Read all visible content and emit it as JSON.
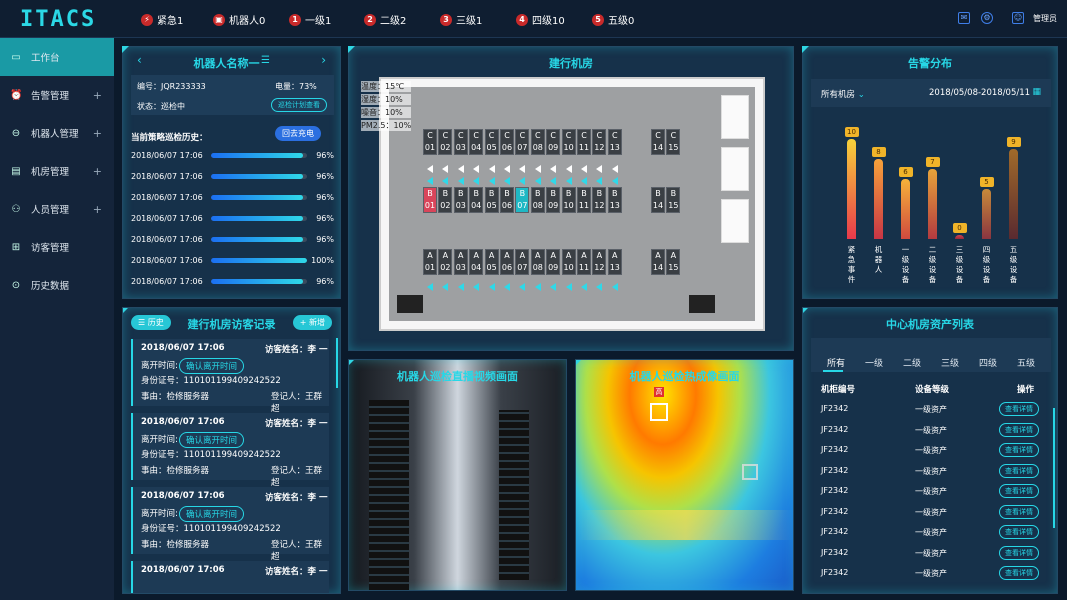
{
  "topbar": {
    "logo": "ITACS",
    "levels": [
      {
        "label": "紧急1",
        "badge": "⚡"
      },
      {
        "label": "机器人0",
        "badge": "▣"
      },
      {
        "label": "一级1",
        "badge": "1"
      },
      {
        "label": "二级2",
        "badge": "2"
      },
      {
        "label": "三级1",
        "badge": "3"
      },
      {
        "label": "四级10",
        "badge": "4"
      },
      {
        "label": "五级0",
        "badge": "5"
      }
    ],
    "mail_icon": "mail-icon",
    "settings_icon": "gear-icon",
    "user_label": "管理员"
  },
  "sidebar": {
    "items": [
      {
        "label": "工作台",
        "icon": "▭"
      },
      {
        "label": "告警管理",
        "icon": "⏰",
        "plus": "+"
      },
      {
        "label": "机器人管理",
        "icon": "⊖",
        "plus": "+"
      },
      {
        "label": "机房管理",
        "icon": "▤",
        "plus": "+"
      },
      {
        "label": "人员管理",
        "icon": "⚇",
        "plus": "+"
      },
      {
        "label": "访客管理",
        "icon": "⊞"
      },
      {
        "label": "历史数据",
        "icon": "⊙"
      }
    ]
  },
  "robot": {
    "title": "机器人名称一",
    "id": "编号：JQR233333",
    "battery": "电量：73%",
    "status": "状态：巡检中",
    "plan_btn": "巡检计划查看",
    "history_title": "当前策略巡检历史：",
    "recharge_btn": "回去充电",
    "history": [
      {
        "time": "2018/06/07  17:06",
        "value": 0.96,
        "pct": "96%"
      },
      {
        "time": "2018/06/07  17:06",
        "value": 0.96,
        "pct": "96%"
      },
      {
        "time": "2018/06/07  17:06",
        "value": 0.96,
        "pct": "96%"
      },
      {
        "time": "2018/06/07  17:06",
        "value": 0.96,
        "pct": "96%"
      },
      {
        "time": "2018/06/07  17:06",
        "value": 0.96,
        "pct": "96%"
      },
      {
        "time": "2018/06/07  17:06",
        "value": 1.0,
        "pct": "100%"
      },
      {
        "time": "2018/06/07  17:06",
        "value": 0.96,
        "pct": "96%"
      }
    ]
  },
  "visitors": {
    "history_btn": "历史",
    "title": "建行机房访客记录",
    "add_btn": "+ 新增",
    "cards": [
      {
        "date": "2018/06/07  17:06",
        "name": "访客姓名：李  一",
        "leave": "离开时间:",
        "leave_btn": "确认离开时间",
        "idno": "身份证号：110101199409242522",
        "reason": "事由：检修服务器",
        "reg": "登记人：王群超"
      },
      {
        "date": "2018/06/07  17:06",
        "name": "访客姓名：李  一",
        "leave": "离开时间:",
        "leave_btn": "确认离开时间",
        "idno": "身份证号：110101199409242522",
        "reason": "事由：检修服务器",
        "reg": "登记人：王群超"
      },
      {
        "date": "2018/06/07  17:06",
        "name": "访客姓名：李  一",
        "leave": "离开时间:",
        "leave_btn": "确认离开时间",
        "idno": "身份证号：110101199409242522",
        "reason": "事由：检修服务器",
        "reg": "登记人：王群超"
      },
      {
        "date": "2018/06/07  17:06",
        "name": "访客姓名：李  一"
      }
    ]
  },
  "room": {
    "title": "建行机房",
    "sensors": [
      "温度：15℃",
      "湿度：10%",
      "噪音：10%",
      "PM2.5：10%"
    ],
    "rowC": [
      "01",
      "02",
      "03",
      "04",
      "05",
      "06",
      "07",
      "08",
      "09",
      "10",
      "11",
      "12",
      "13"
    ],
    "rowC2": [
      "14",
      "15"
    ]
  },
  "camera": {
    "title": "机器人巡检直播视频画面"
  },
  "thermal": {
    "title": "机器人巡检热成像画面",
    "hot_label": "高"
  },
  "alarm": {
    "title": "告警分布",
    "room_select": "所有机房",
    "date_range": "2018/05/08-2018/05/11"
  },
  "assets": {
    "title": "中心机房资产列表",
    "tabs": [
      "所有",
      "一级",
      "二级",
      "三级",
      "四级",
      "五级"
    ],
    "headers": [
      "机柜编号",
      "设备等级",
      "操作"
    ],
    "rows": [
      {
        "id": "JF2342",
        "level": "一级资产",
        "op": "查看详情"
      },
      {
        "id": "JF2342",
        "level": "一级资产",
        "op": "查看详情"
      },
      {
        "id": "JF2342",
        "level": "一级资产",
        "op": "查看详情"
      },
      {
        "id": "JF2342",
        "level": "一级资产",
        "op": "查看详情"
      },
      {
        "id": "JF2342",
        "level": "一级资产",
        "op": "查看详情"
      },
      {
        "id": "JF2342",
        "level": "一级资产",
        "op": "查看详情"
      },
      {
        "id": "JF2342",
        "level": "一级资产",
        "op": "查看详情"
      },
      {
        "id": "JF2342",
        "level": "一级资产",
        "op": "查看详情"
      },
      {
        "id": "JF2342",
        "level": "一级资产",
        "op": "查看详情"
      }
    ]
  },
  "chart_data": {
    "type": "bar",
    "categories": [
      "紧急事件",
      "机器人",
      "一级设备",
      "二级设备",
      "三级设备",
      "四级设备",
      "五级设备"
    ],
    "values": [
      10,
      8,
      6,
      7,
      0,
      5,
      9
    ],
    "colors": [
      [
        "#f7d23a",
        "#e8394b"
      ],
      [
        "#f7a23a",
        "#c83545"
      ],
      [
        "#f7b23a",
        "#d04a3e"
      ],
      [
        "#e8a43a",
        "#b33a40"
      ],
      [
        "#d04050",
        "#9a2a3a"
      ],
      [
        "#c88a3a",
        "#8a3540"
      ],
      [
        "#a06a2a",
        "#5a2a30"
      ]
    ]
  }
}
